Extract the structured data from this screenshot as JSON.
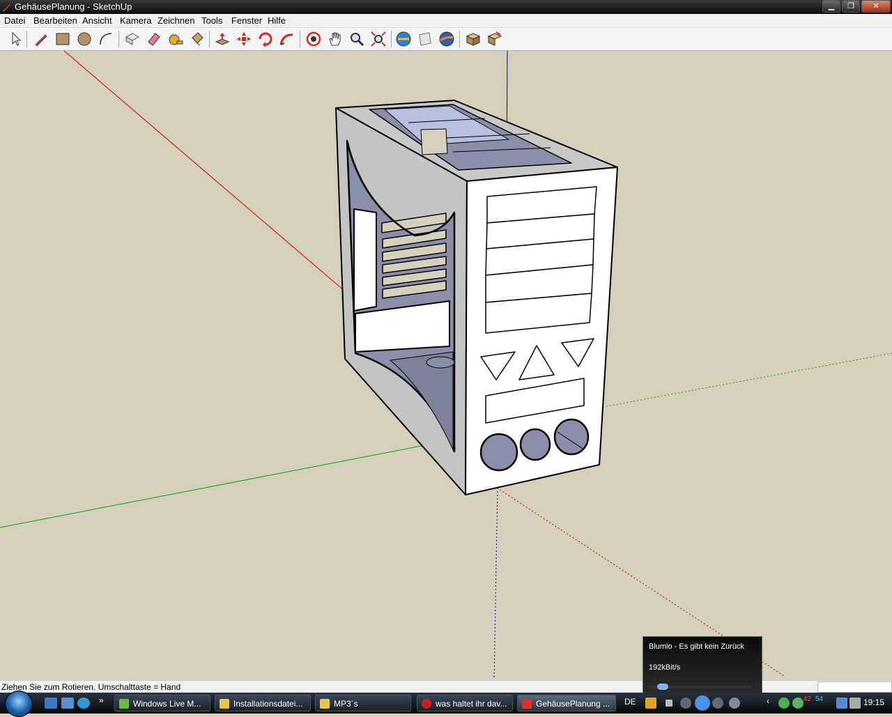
{
  "window": {
    "title": "GehäusePlanung - SketchUp"
  },
  "menu": [
    "Datei",
    "Bearbeiten",
    "Ansicht",
    "Kamera",
    "Zeichnen",
    "Tools",
    "Fenster",
    "Hilfe"
  ],
  "toolbar": {
    "tools": [
      "select-tool",
      "line-tool",
      "rectangle-tool",
      "circle-tool",
      "arc-tool",
      "make-component-tool",
      "eraser-tool",
      "tape-measure-tool",
      "paint-bucket-tool",
      "push-pull-tool",
      "move-tool",
      "rotate-tool",
      "follow-me-tool",
      "orbit-tool",
      "pan-tool",
      "zoom-tool",
      "zoom-extents-tool",
      "get-models-tool",
      "share-model-tool",
      "google-earth-tool",
      "component-browser-tool",
      "share-component-tool"
    ]
  },
  "status": {
    "text": "Ziehen Sie zum Rotieren.  Umschalttaste = Hand"
  },
  "taskbar": {
    "tasks": [
      "Windows Live M...",
      "Installationsdatei...",
      "MP3´s",
      "was haltet ihr dav...",
      "GehäusePlanung ..."
    ],
    "language": "DE",
    "clock": "19:15",
    "tray_numbers": [
      "42",
      "54"
    ]
  },
  "media_player": {
    "song": "Blumio - Es gibt kein Zurück",
    "bitrate": "192kBit/s"
  },
  "colors": {
    "background": "#d4d0bc",
    "x_axis": "#cc0000",
    "y_axis": "#009900",
    "z_axis": "#0000cc",
    "model_front": "#ffffff",
    "model_side": "#c9c9c9",
    "model_inner": "#8a8ea8"
  }
}
